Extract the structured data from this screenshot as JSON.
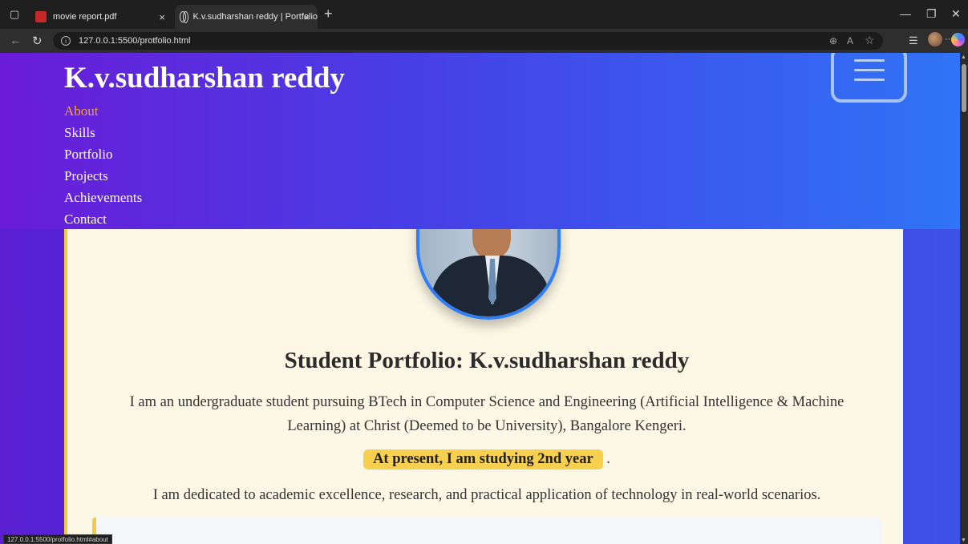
{
  "browser": {
    "tabs": [
      {
        "title": "movie report.pdf",
        "active": false
      },
      {
        "title": "K.v.sudharshan reddy | Portfolio",
        "active": true
      }
    ],
    "address": "127.0.0.1:5500/protfolio.html",
    "status_url": "127.0.0.1:5500/protfolio.html#about",
    "icons": {
      "new_tab": "+",
      "close": "×",
      "back": "←",
      "refresh": "↻",
      "minimize": "—",
      "restore": "❐",
      "close_window": "✕",
      "zoom": "⊕",
      "read_aloud": "A",
      "favorite": "☆",
      "favorites": "☰",
      "more": "···"
    }
  },
  "site": {
    "title": "K.v.sudharshan reddy",
    "nav": [
      {
        "label": "About",
        "active": true
      },
      {
        "label": "Skills",
        "active": false
      },
      {
        "label": "Portfolio",
        "active": false
      },
      {
        "label": "Projects",
        "active": false
      },
      {
        "label": "Achievements",
        "active": false
      },
      {
        "label": "Contact",
        "active": false
      }
    ]
  },
  "about": {
    "heading": "Student Portfolio: K.v.sudharshan reddy",
    "intro": "I am an undergraduate student pursuing BTech in Computer Science and Engineering (Artificial Intelligence & Machine Learning) at Christ (Deemed to be University), Bangalore Kengeri.",
    "year_highlight": "At present, I am studying 2nd year",
    "year_suffix": ".",
    "dedication": "I am dedicated to academic excellence, research, and practical application of technology in real-world scenarios."
  },
  "colors": {
    "header_start": "#6a1cd8",
    "header_end": "#2f74f6",
    "nav_active": "#f5a623",
    "card_bg": "#fdf8e6",
    "accent_yellow": "#f7d04f",
    "photo_border": "#2f7ef6"
  }
}
